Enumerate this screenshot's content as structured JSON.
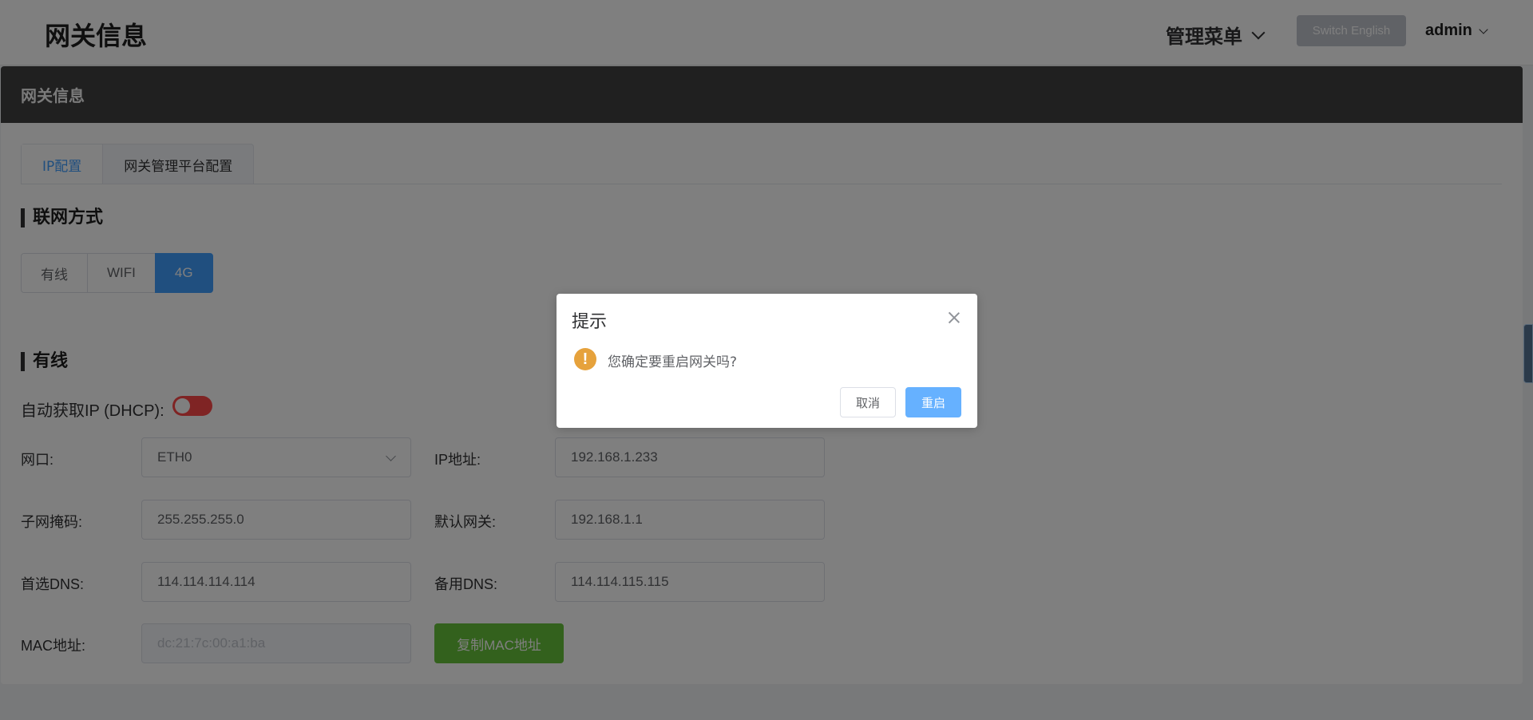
{
  "header": {
    "title": "网关信息",
    "menu_label": "管理菜单",
    "lang_button": "Switch English",
    "user": "admin"
  },
  "card": {
    "title": "网关信息",
    "tabs": [
      {
        "label": "IP配置",
        "active": true
      },
      {
        "label": "网关管理平台配置",
        "active": false
      }
    ]
  },
  "network": {
    "section_title": "联网方式",
    "options": [
      {
        "label": "有线",
        "active": false
      },
      {
        "label": "WIFI",
        "active": false
      },
      {
        "label": "4G",
        "active": true
      }
    ]
  },
  "wired": {
    "section_title": "有线",
    "dhcp_label": "自动获取IP (DHCP):",
    "dhcp_enabled": false,
    "port_label": "网口:",
    "port_value": "ETH0",
    "ip_label": "IP地址:",
    "ip_value": "192.168.1.233",
    "mask_label": "子网掩码:",
    "mask_value": "255.255.255.0",
    "gateway_label": "默认网关:",
    "gateway_value": "192.168.1.1",
    "dns1_label": "首选DNS:",
    "dns1_value": "114.114.114.114",
    "dns2_label": "备用DNS:",
    "dns2_value": "114.114.115.115",
    "mac_label": "MAC地址:",
    "mac_value": "dc:21:7c:00:a1:ba",
    "copy_mac_button": "复制MAC地址"
  },
  "dialog": {
    "title": "提示",
    "icon": "warning-icon",
    "message": "您确定要重启网关吗?",
    "cancel_label": "取消",
    "confirm_label": "重启"
  },
  "colors": {
    "primary": "#409eff",
    "success": "#67c23a",
    "warning": "#e6a23c",
    "danger": "#ff4949"
  }
}
